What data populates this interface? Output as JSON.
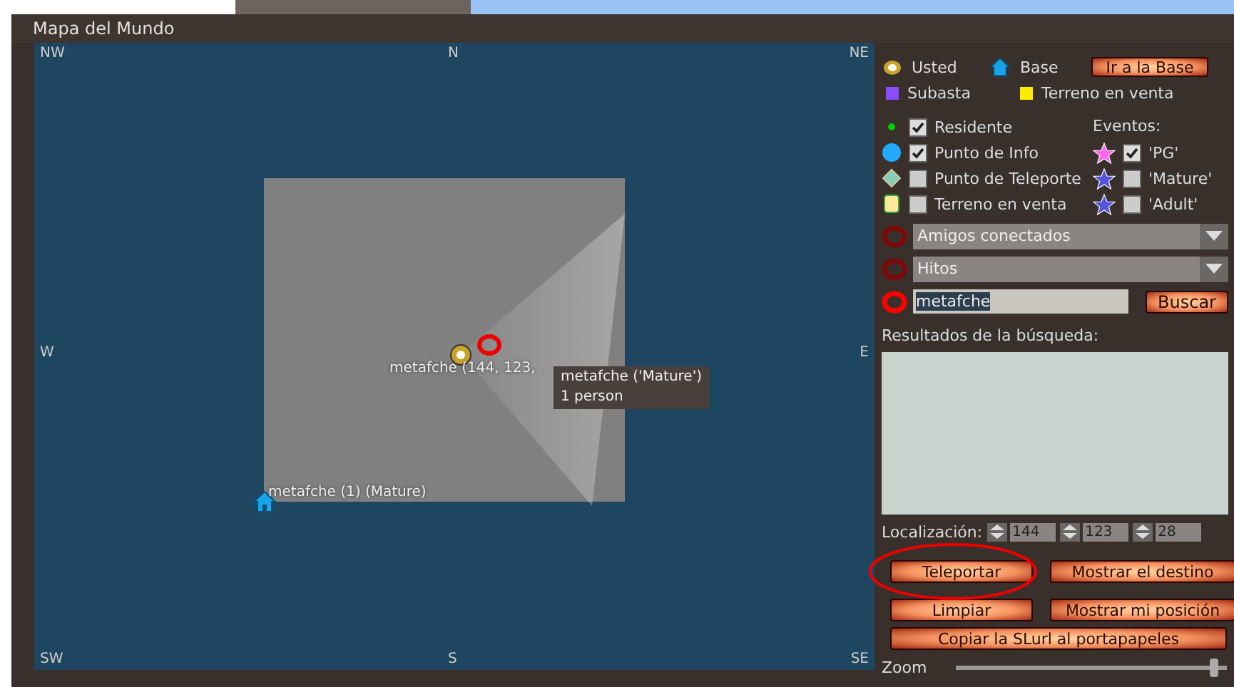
{
  "window": {
    "title": "Mapa del Mundo"
  },
  "map": {
    "compass": [
      "NW",
      "N",
      "NE",
      "W",
      "E",
      "SW",
      "S",
      "SE"
    ],
    "avatar_label": "metafche (144, 123,",
    "home_label": "metafche (1) (Mature)",
    "tooltip": [
      "metafche ('Mature')",
      "1 person"
    ]
  },
  "legend": {
    "you": "Usted",
    "home": "Base",
    "go_home_button": "Ir a la Base",
    "auction": "Subasta",
    "land_for_sale": "Terreno en venta"
  },
  "filters": [
    {
      "kind": "resident",
      "label": "Residente",
      "checked": true
    },
    {
      "kind": "info",
      "label": "Punto de Info",
      "checked": true
    },
    {
      "kind": "teleport",
      "label": "Punto de Teleporte",
      "checked": false
    },
    {
      "kind": "sale",
      "label": "Terreno en venta",
      "checked": false
    }
  ],
  "events_label": "Eventos:",
  "events": [
    {
      "kind": "pg",
      "label": "'PG'",
      "checked": true
    },
    {
      "kind": "mature",
      "label": "'Mature'",
      "checked": false
    },
    {
      "kind": "adult",
      "label": "'Adult'",
      "checked": false
    }
  ],
  "dropdowns": [
    "Amigos conectados",
    "Hitos"
  ],
  "search": {
    "value": "metafche",
    "button": "Buscar"
  },
  "results_label": "Resultados de la búsqueda:",
  "location": {
    "label": "Localización:",
    "values": [
      "144",
      "123",
      "28"
    ]
  },
  "buttons": [
    "Teleportar",
    "Mostrar el destino",
    "Limpiar",
    "Mostrar mi posición"
  ],
  "copy_button": "Copiar la SLurl al portapapeles",
  "zoom": {
    "label": "Zoom",
    "level": 0.97
  }
}
